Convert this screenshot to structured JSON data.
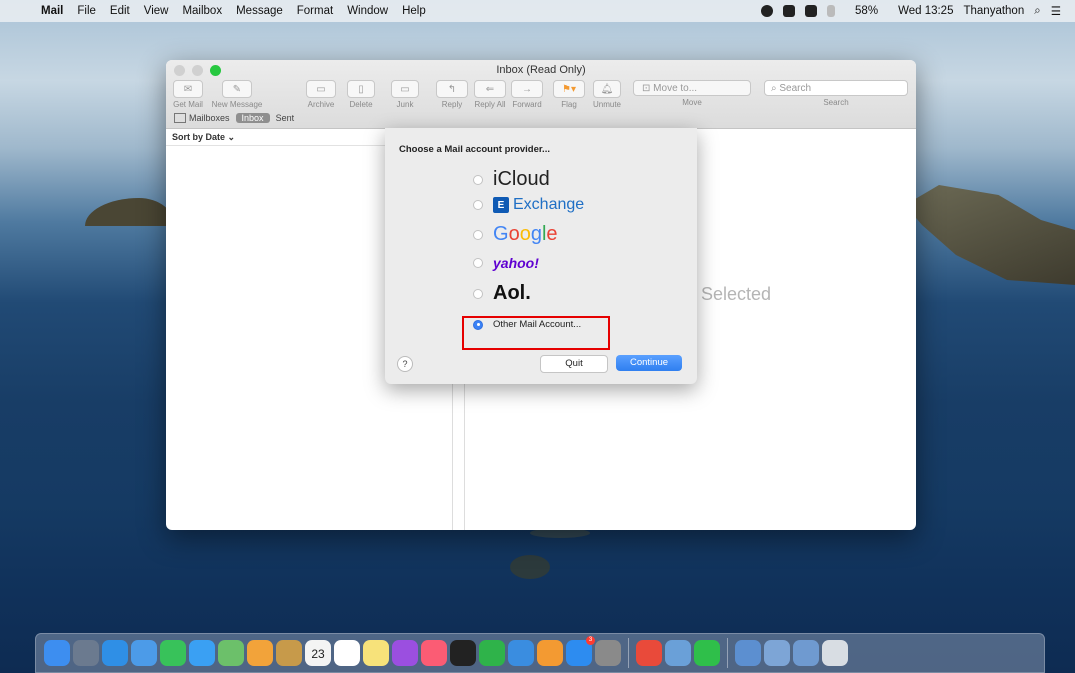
{
  "menubar": {
    "app": "Mail",
    "items": [
      "File",
      "Edit",
      "View",
      "Mailbox",
      "Message",
      "Format",
      "Window",
      "Help"
    ],
    "battery": "58%",
    "clock": "Wed 13:25",
    "user": "Thanyathon"
  },
  "window": {
    "title": "Inbox (Read Only)",
    "toolbar": {
      "get_mail": "Get Mail",
      "new_message": "New Message",
      "archive": "Archive",
      "delete": "Delete",
      "junk": "Junk",
      "reply": "Reply",
      "reply_all": "Reply All",
      "forward": "Forward",
      "flag": "Flag",
      "unmute": "Unmute",
      "move_to": "Move to...",
      "move": "Move",
      "search_placeholder": "Search",
      "search": "Search"
    },
    "favorites": {
      "mailboxes": "Mailboxes",
      "inbox": "Inbox",
      "sent": "Sent"
    },
    "sort": "Sort by Date",
    "no_selection": "e Selected"
  },
  "sheet": {
    "title": "Choose a Mail account provider...",
    "providers": {
      "icloud": "iCloud",
      "exchange": "Exchange",
      "google": [
        "G",
        "o",
        "o",
        "g",
        "l",
        "e"
      ],
      "yahoo": "yahoo!",
      "aol": "Aol.",
      "other": "Other Mail Account..."
    },
    "selected": "other",
    "help": "?",
    "quit": "Quit",
    "continue": "Continue"
  },
  "colors": {
    "accent": "#3b82f6",
    "highlight": "#e60000",
    "traffic_green": "#27c840"
  },
  "dock": {
    "icons": [
      {
        "name": "finder-icon",
        "color": "#3d8ef0"
      },
      {
        "name": "launchpad-icon",
        "color": "#6b7a8f"
      },
      {
        "name": "safari-icon",
        "color": "#2f8fe6"
      },
      {
        "name": "mail-icon",
        "color": "#4c9be8"
      },
      {
        "name": "facetime-icon",
        "color": "#38c25a"
      },
      {
        "name": "messages-icon",
        "color": "#3aa0f3"
      },
      {
        "name": "maps-icon",
        "color": "#6cc06a"
      },
      {
        "name": "photos-icon",
        "color": "#f2a33a"
      },
      {
        "name": "contacts-icon",
        "color": "#c79a4a"
      },
      {
        "name": "calendar-icon",
        "color": "#f4f4f4"
      },
      {
        "name": "reminders-icon",
        "color": "#ffffff"
      },
      {
        "name": "notes-icon",
        "color": "#f7e27a"
      },
      {
        "name": "podcasts-icon",
        "color": "#9b4fe0"
      },
      {
        "name": "music-icon",
        "color": "#fb5c74"
      },
      {
        "name": "tv-icon",
        "color": "#222222"
      },
      {
        "name": "numbers-icon",
        "color": "#2fb34a"
      },
      {
        "name": "keynote-icon",
        "color": "#3a8de0"
      },
      {
        "name": "pages-icon",
        "color": "#f39a32"
      },
      {
        "name": "app-store-icon",
        "color": "#2d8cf0"
      },
      {
        "name": "system-preferences-icon",
        "color": "#8a8a8a"
      },
      {
        "name": "chrome-icon",
        "color": "#e94a3a"
      },
      {
        "name": "preview-icon",
        "color": "#6aa0d8"
      },
      {
        "name": "line-icon",
        "color": "#2fbf4a"
      },
      {
        "name": "downloads-icon",
        "color": "#5c8fd0"
      },
      {
        "name": "screenshot-icon",
        "color": "#7da5d6"
      },
      {
        "name": "window-icon",
        "color": "#6f9ad0"
      },
      {
        "name": "trash-icon",
        "color": "#d8dde3"
      }
    ],
    "calendar_date": "23",
    "app_store_badge": "3"
  }
}
